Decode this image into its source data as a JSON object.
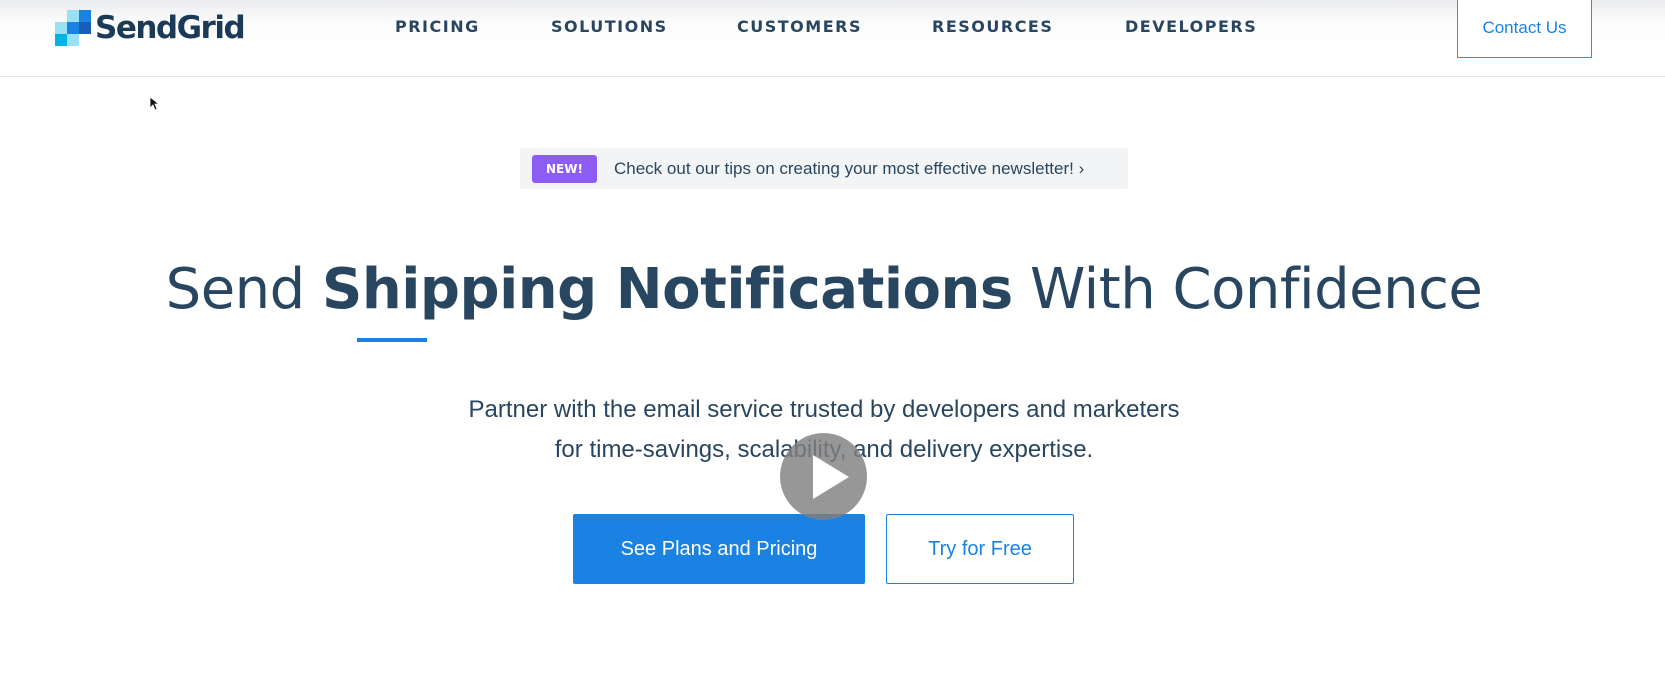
{
  "header": {
    "logo_text": "SendGrid",
    "nav": [
      {
        "label": "PRICING"
      },
      {
        "label": "SOLUTIONS"
      },
      {
        "label": "CUSTOMERS"
      },
      {
        "label": "RESOURCES"
      },
      {
        "label": "DEVELOPERS"
      }
    ],
    "contact_label": "Contact Us"
  },
  "announcement": {
    "badge": "NEW!",
    "text": "Check out our tips on creating your most effective newsletter! ›"
  },
  "hero": {
    "title_pre": "Send",
    "title_strong": "Shipping Notifications",
    "title_post": "With Confidence",
    "subtitle_line1": "Partner with the email service trusted by developers and marketers",
    "subtitle_line2": "for time-savings, scalability, and delivery expertise.",
    "primary_cta": "See Plans and Pricing",
    "secondary_cta": "Try for Free"
  },
  "icons": {
    "logo": "sendgrid-logo-icon",
    "cursor": "mouse-pointer-icon",
    "play": "play-icon"
  },
  "colors": {
    "brand_blue": "#1a82e2",
    "navy_text": "#294661",
    "badge_purple": "#8c5cf5",
    "announce_bg": "#f3f4f6"
  }
}
